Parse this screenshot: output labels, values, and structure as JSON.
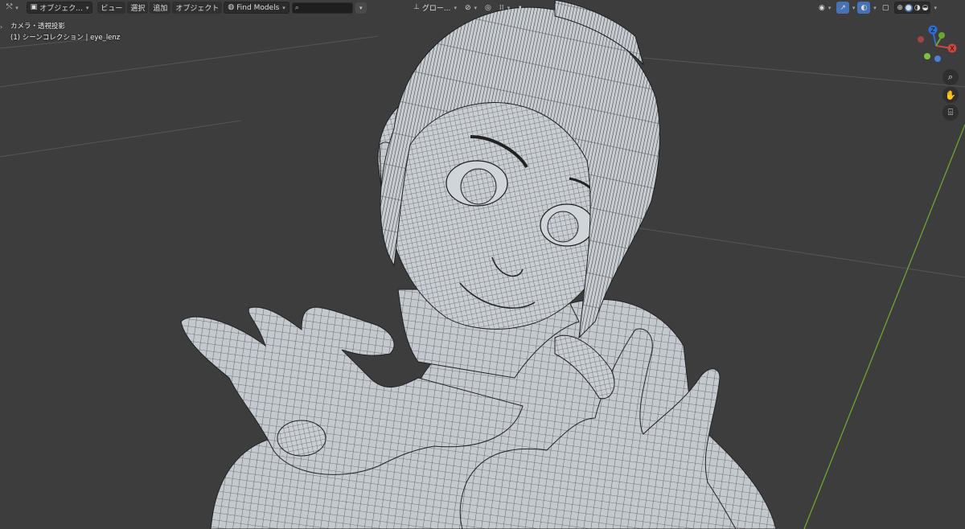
{
  "header": {
    "editor_type_icon": "axis-view-icon",
    "mode_label": "オブジェク...",
    "menus": [
      "ビュー",
      "選択",
      "追加",
      "オブジェクト"
    ],
    "find_models_label": "Find Models",
    "search_value": "",
    "transform_orientation_label": "グロー...",
    "shading_modes": [
      "wireframe",
      "solid",
      "material",
      "rendered"
    ],
    "active_shading": "solid"
  },
  "overlay": {
    "view_name": "カメラ・透視投影",
    "collection_info": "(1) シーンコレクション | eye_lenz"
  },
  "gizmo": {
    "z_label": "Z",
    "x_label": "X",
    "y_label": "Y",
    "colors": {
      "x": "#d0453f",
      "y": "#6aa72e",
      "z": "#2e6fd4",
      "neg": "#7a3a3a"
    }
  },
  "nav": [
    "zoom-icon",
    "hand-icon",
    "camera-icon"
  ],
  "colors": {
    "background": "#3d3d3d",
    "accent": "#4772b3",
    "mesh_fill": "#b9c0c6",
    "mesh_wire": "#1a1a1a",
    "y_axis_line": "#6aa72e"
  }
}
